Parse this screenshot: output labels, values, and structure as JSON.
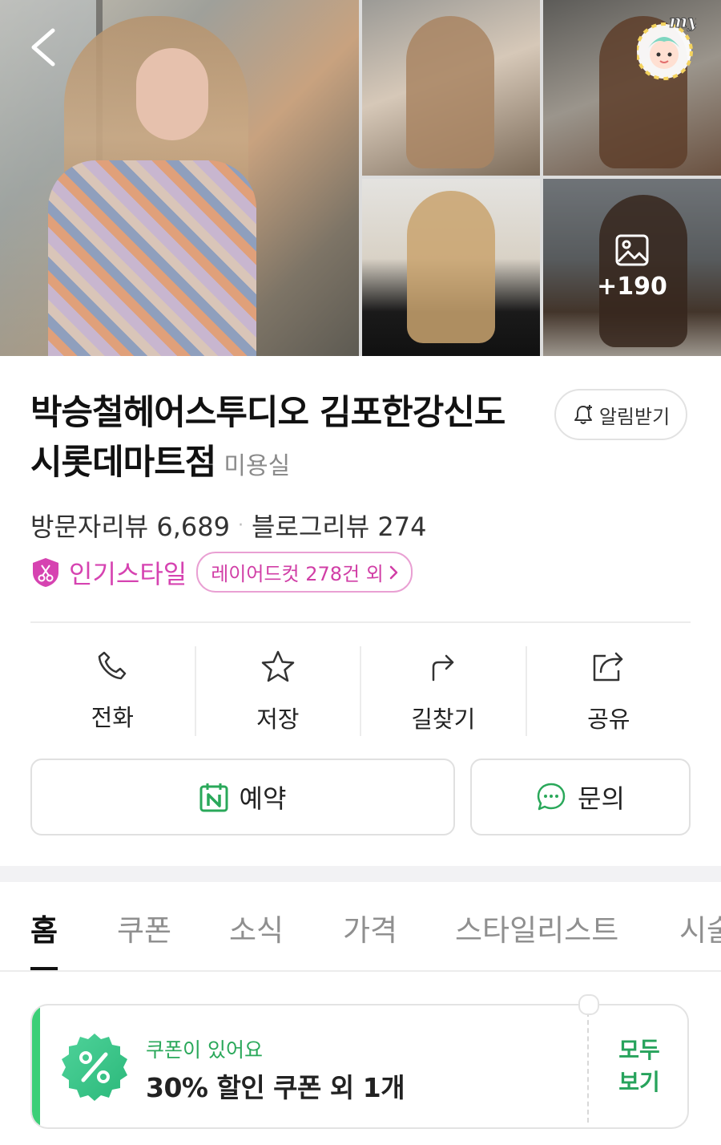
{
  "gallery": {
    "more_count": "+190",
    "badge_text": "my"
  },
  "header": {
    "title": "박승철헤어스투디오 김포한강신도시롯데마트점",
    "category": "미용실",
    "notify_label": "알림받기"
  },
  "reviews": {
    "visitor": "방문자리뷰 6,689",
    "blog": "블로그리뷰 274",
    "separator": "·"
  },
  "popular": {
    "label": "인기스타일",
    "chip": "레이어드컷 278건 외"
  },
  "actions": [
    {
      "label": "전화",
      "icon": "phone-icon"
    },
    {
      "label": "저장",
      "icon": "star-icon"
    },
    {
      "label": "길찾기",
      "icon": "directions-icon"
    },
    {
      "label": "공유",
      "icon": "share-icon"
    }
  ],
  "buttons": {
    "reserve": "예약",
    "inquiry": "문의"
  },
  "tabs": [
    "홈",
    "쿠폰",
    "소식",
    "가격",
    "스타일리스트",
    "시술"
  ],
  "coupon": {
    "sub": "쿠폰이 있어요",
    "main": "30% 할인 쿠폰 외 1개",
    "more_line1": "모두",
    "more_line2": "보기"
  },
  "colors": {
    "accent_green": "#2aa85a",
    "popular_pink": "#d643b1"
  }
}
